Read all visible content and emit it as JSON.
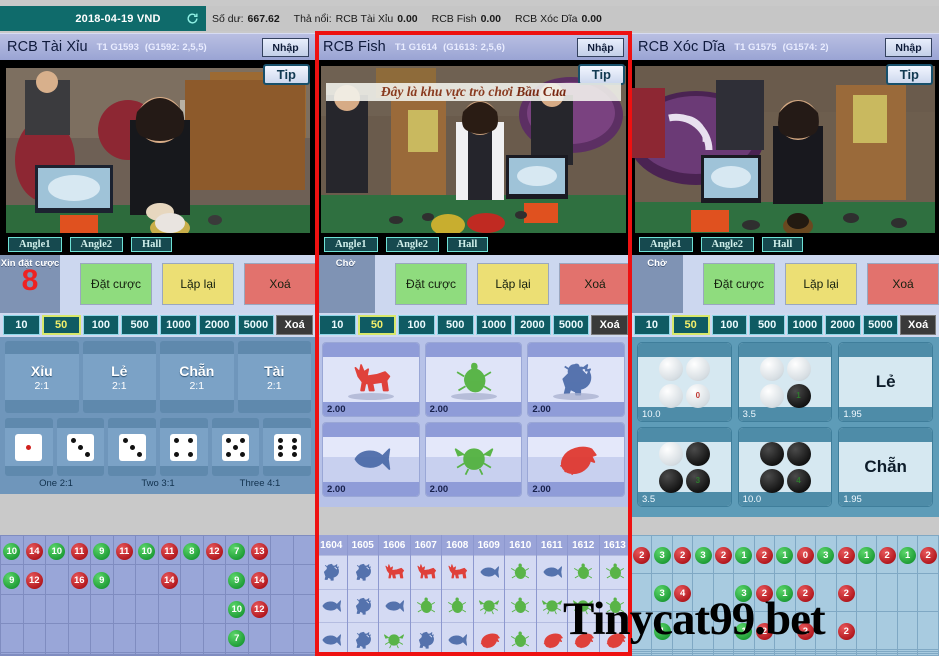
{
  "topbar": {
    "date_currency": "2018-04-19 VND",
    "refresh_icon": "refresh-icon",
    "balance_label": "Số dư:",
    "balance_value": "667.62",
    "floating_label": "Thả nổi:",
    "floating": [
      {
        "name": "RCB Tài Xỉu",
        "value": "0.00"
      },
      {
        "name": "RCB Fish",
        "value": "0.00"
      },
      {
        "name": "RCB Xóc Dĩa",
        "value": "0.00"
      }
    ]
  },
  "panels": [
    {
      "id": "taixiu",
      "title": "RCB Tài Xỉu",
      "round": "T1 G1593",
      "prev": "(G1592: 2,5,5)",
      "enter_label": "Nhập",
      "tip_label": "Tip",
      "view_buttons": [
        "Angle1",
        "Angle2",
        "Hall"
      ],
      "overlay_message": "",
      "status_label": "Xin đặt cược",
      "status_number": "8",
      "actions": [
        {
          "label": "Đặt cược",
          "style": "green"
        },
        {
          "label": "Lặp lại",
          "style": "yellow"
        },
        {
          "label": "Xoá",
          "style": "red"
        }
      ],
      "chips": [
        "10",
        "50",
        "100",
        "500",
        "1000",
        "2000",
        "5000"
      ],
      "chip_selected": "50",
      "chip_clear_label": "Xoá",
      "bets": [
        {
          "name": "Xỉu",
          "odds": "2:1"
        },
        {
          "name": "Lẻ",
          "odds": "2:1"
        },
        {
          "name": "Chẵn",
          "odds": "2:1"
        },
        {
          "name": "Tài",
          "odds": "2:1"
        }
      ],
      "dice": [
        1,
        3,
        3,
        4,
        5,
        6
      ],
      "dice_labels": [
        "One 2:1",
        "Two 3:1",
        "Three 4:1"
      ]
    },
    {
      "id": "fish",
      "title": "RCB Fish",
      "round": "T1 G1614",
      "prev": "(G1613: 2,5,6)",
      "enter_label": "Nhập",
      "tip_label": "Tip",
      "view_buttons": [
        "Angle1",
        "Angle2",
        "Hall"
      ],
      "overlay_message": "Đây là khu vực trò chơi ",
      "overlay_message_bold": "Bầu Cua",
      "status_label": "Chờ",
      "status_number": "",
      "actions": [
        {
          "label": "Đặt cược",
          "style": "green"
        },
        {
          "label": "Lặp lại",
          "style": "yellow"
        },
        {
          "label": "Xoá",
          "style": "red"
        }
      ],
      "chips": [
        "10",
        "50",
        "100",
        "500",
        "1000",
        "2000",
        "5000"
      ],
      "chip_selected": "50",
      "chip_clear_label": "Xoá",
      "tiles": [
        {
          "animal": "deer",
          "color": "#e0342b",
          "odds": "2.00",
          "water": false
        },
        {
          "animal": "gourd",
          "color": "#4fb13a",
          "odds": "2.00",
          "water": false
        },
        {
          "animal": "rooster",
          "color": "#4a6aa8",
          "odds": "2.00",
          "water": false
        },
        {
          "animal": "fish",
          "color": "#4a6aa8",
          "odds": "2.00",
          "water": true
        },
        {
          "animal": "crab",
          "color": "#4fb13a",
          "odds": "2.00",
          "water": true
        },
        {
          "animal": "shrimp",
          "color": "#e0342b",
          "odds": "2.00",
          "water": true
        }
      ]
    },
    {
      "id": "xocdia",
      "title": "RCB Xóc Dĩa",
      "round": "T1 G1575",
      "prev": "(G1574: 2)",
      "enter_label": "Nhập",
      "tip_label": "Tip",
      "view_buttons": [
        "Angle1",
        "Angle2",
        "Hall"
      ],
      "overlay_message": "",
      "status_label": "Chờ",
      "status_number": "",
      "actions": [
        {
          "label": "Đặt cược",
          "style": "green"
        },
        {
          "label": "Lặp lại",
          "style": "yellow"
        },
        {
          "label": "Xoá",
          "style": "red"
        }
      ],
      "chips": [
        "10",
        "50",
        "100",
        "500",
        "1000",
        "2000",
        "5000"
      ],
      "chip_selected": "50",
      "chip_clear_label": "Xoá",
      "tiles": [
        {
          "kind": "coins",
          "white": 4,
          "black": 0,
          "odds": "10.0"
        },
        {
          "kind": "coins",
          "white": 3,
          "black": 1,
          "odds": "3.5"
        },
        {
          "kind": "word",
          "word": "Lẻ",
          "odds": "1.95"
        },
        {
          "kind": "coins",
          "white": 1,
          "black": 3,
          "odds": "3.5"
        },
        {
          "kind": "coins",
          "white": 0,
          "black": 4,
          "odds": "10.0"
        },
        {
          "kind": "word",
          "word": "Chẵn",
          "odds": "1.95"
        }
      ]
    }
  ],
  "history_taixiu": {
    "columns": 14,
    "rows": 6,
    "cells": [
      [
        {
          "v": "10",
          "c": "g"
        },
        {
          "v": "14",
          "c": "r"
        },
        {
          "v": "10",
          "c": "g"
        },
        {
          "v": "11",
          "c": "r"
        },
        {
          "v": "9",
          "c": "g"
        },
        {
          "v": "11",
          "c": "r"
        },
        {
          "v": "10",
          "c": "g"
        },
        {
          "v": "11",
          "c": "r"
        },
        {
          "v": "8",
          "c": "g"
        },
        {
          "v": "12",
          "c": "r"
        },
        {
          "v": "7",
          "c": "g"
        },
        {
          "v": "13",
          "c": "r"
        },
        null,
        null
      ],
      [
        {
          "v": "9",
          "c": "g"
        },
        {
          "v": "12",
          "c": "r"
        },
        null,
        {
          "v": "16",
          "c": "r"
        },
        {
          "v": "9",
          "c": "g"
        },
        null,
        null,
        {
          "v": "14",
          "c": "r"
        },
        null,
        null,
        {
          "v": "9",
          "c": "g"
        },
        {
          "v": "14",
          "c": "r"
        },
        null,
        null
      ],
      [
        null,
        null,
        null,
        null,
        null,
        null,
        null,
        null,
        null,
        null,
        {
          "v": "10",
          "c": "g"
        },
        {
          "v": "12",
          "c": "r"
        },
        null,
        null
      ],
      [
        null,
        null,
        null,
        null,
        null,
        null,
        null,
        null,
        null,
        null,
        {
          "v": "7",
          "c": "g"
        },
        null,
        null,
        null
      ],
      [
        null,
        null,
        null,
        null,
        null,
        null,
        null,
        null,
        null,
        null,
        null,
        null,
        null,
        null
      ],
      [
        null,
        null,
        null,
        null,
        null,
        null,
        null,
        null,
        null,
        null,
        null,
        null,
        null,
        null
      ]
    ]
  },
  "history_fish": {
    "game_ids": [
      "1604",
      "1605",
      "1606",
      "1607",
      "1608",
      "1609",
      "1610",
      "1611",
      "1612",
      "1613"
    ],
    "results": [
      [
        "rooster",
        "fish",
        "fish"
      ],
      [
        "rooster",
        "rooster",
        "rooster"
      ],
      [
        "deer",
        "fish",
        "crab"
      ],
      [
        "deer",
        "gourd",
        "rooster"
      ],
      [
        "deer",
        "gourd",
        "fish"
      ],
      [
        "fish",
        "crab",
        "shrimp"
      ],
      [
        "gourd",
        "gourd",
        "gourd"
      ],
      [
        "fish",
        "crab",
        "shrimp"
      ],
      [
        "gourd",
        "crab",
        "shrimp"
      ],
      [
        "gourd",
        "gourd",
        "shrimp"
      ]
    ],
    "colors": {
      "deer": "#e0342b",
      "gourd": "#4fb13a",
      "rooster": "#4a6aa8",
      "fish": "#4a6aa8",
      "crab": "#4fb13a",
      "shrimp": "#e0342b"
    }
  },
  "history_xocdia": {
    "columns": 15,
    "rows": 6,
    "cells": [
      [
        {
          "v": "2",
          "c": "r"
        },
        {
          "v": "3",
          "c": "g"
        },
        {
          "v": "2",
          "c": "r"
        },
        {
          "v": "3",
          "c": "g"
        },
        {
          "v": "2",
          "c": "r"
        },
        {
          "v": "1",
          "c": "g"
        },
        {
          "v": "2",
          "c": "r"
        },
        {
          "v": "1",
          "c": "g"
        },
        {
          "v": "0",
          "c": "r"
        },
        {
          "v": "3",
          "c": "g"
        },
        {
          "v": "2",
          "c": "r"
        },
        {
          "v": "1",
          "c": "g"
        },
        {
          "v": "2",
          "c": "r"
        },
        {
          "v": "1",
          "c": "g"
        },
        {
          "v": "2",
          "c": "r"
        }
      ],
      [
        null,
        {
          "v": "3",
          "c": "g"
        },
        {
          "v": "4",
          "c": "r"
        },
        null,
        null,
        {
          "v": "3",
          "c": "g"
        },
        {
          "v": "2",
          "c": "r"
        },
        {
          "v": "1",
          "c": "g"
        },
        {
          "v": "2",
          "c": "r"
        },
        null,
        {
          "v": "2",
          "c": "r"
        },
        null,
        null,
        null,
        null
      ],
      [
        null,
        {
          "v": "1",
          "c": "g"
        },
        null,
        null,
        null,
        {
          "v": "1",
          "c": "g"
        },
        {
          "v": "2",
          "c": "r"
        },
        null,
        {
          "v": "2",
          "c": "r"
        },
        null,
        {
          "v": "2",
          "c": "r"
        },
        null,
        null,
        null,
        null
      ],
      [
        null,
        null,
        null,
        null,
        null,
        null,
        null,
        null,
        null,
        null,
        null,
        null,
        null,
        null,
        null
      ],
      [
        null,
        null,
        null,
        null,
        null,
        null,
        null,
        null,
        null,
        null,
        null,
        null,
        null,
        null,
        null
      ],
      [
        null,
        null,
        null,
        null,
        null,
        null,
        null,
        null,
        null,
        null,
        null,
        null,
        null,
        null,
        null
      ]
    ]
  },
  "watermark": "Tinycat99.bet",
  "colors": {
    "accent_red": "#ee1111",
    "header_teal": "#0f6b6b",
    "panel_header": "#9aa4d4"
  }
}
